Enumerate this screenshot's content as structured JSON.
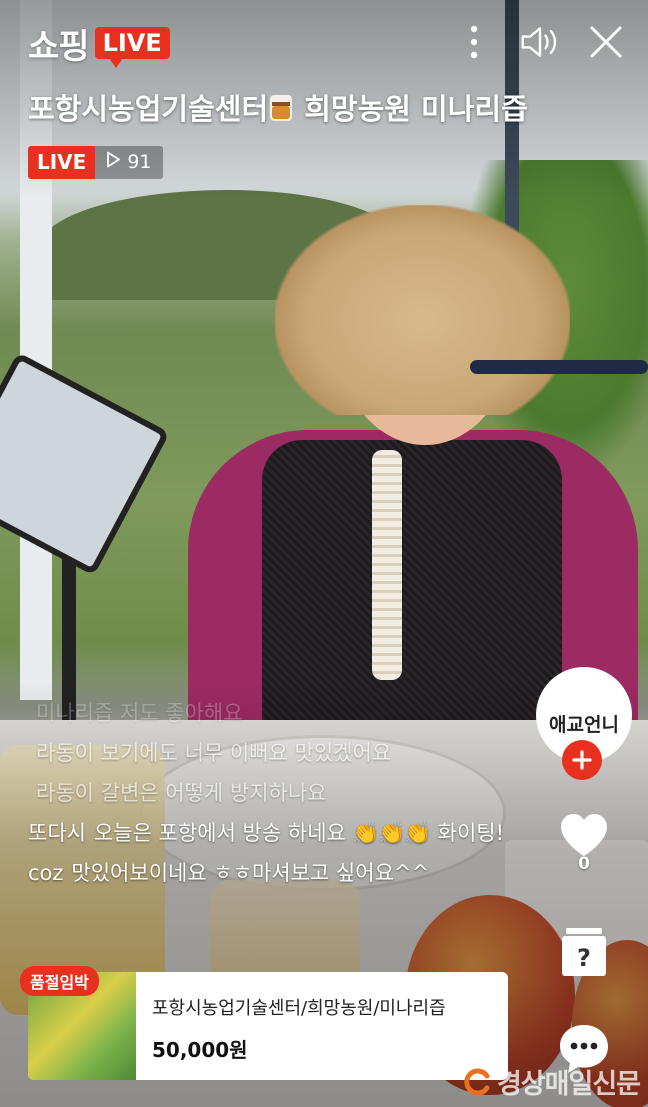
{
  "header": {
    "brand": "쇼핑",
    "live_logo": "LIVE",
    "icons": [
      "more-vertical-icon",
      "speaker-icon",
      "close-icon"
    ]
  },
  "broadcast": {
    "title_part1": "포항시농업기술센터",
    "title_part2": "희망농원 미나리즙",
    "live_badge": "LIVE",
    "viewer_count": "91"
  },
  "chat": [
    {
      "user": "",
      "text": "미나리즙 저도 좋아해요"
    },
    {
      "user": "",
      "text": "라동이 보기에도 너무 이뻐요 맛있겠어요"
    },
    {
      "user": "",
      "text": "라동이 갈변은 어떻게 방지하나요"
    },
    {
      "user": "또다시",
      "text": "오늘은 포항에서 방송 하네요 👏👏👏 화이팅!"
    },
    {
      "user": "coz",
      "text": "맛있어보이네요 ㅎㅎ마셔보고 싶어요^^"
    }
  ],
  "host": {
    "name": "애교언니"
  },
  "side_actions": {
    "like_count": "0"
  },
  "product": {
    "tag": "품절임박",
    "name": "포항시농업기술센터/희망농원/미나리즙",
    "price": "50,000원"
  },
  "watermark": "경상매일신문",
  "colors": {
    "accent": "#e8301f"
  }
}
